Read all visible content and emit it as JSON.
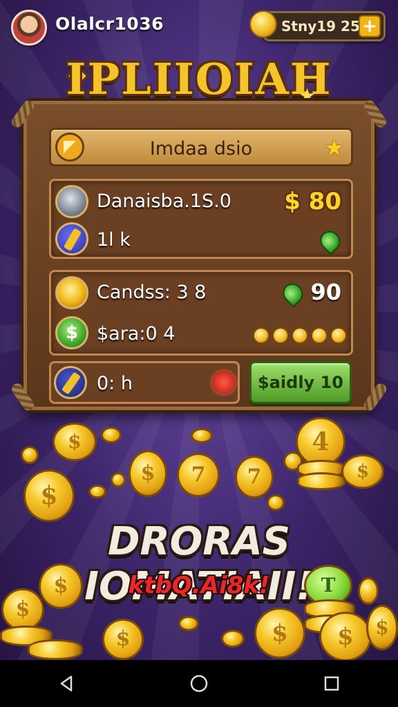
{
  "header": {
    "username": "Olalcr1036",
    "currency_label": "Stny19 25",
    "plus_label": "+"
  },
  "title": "IPLIIOIAH",
  "board": {
    "header_text": "Imdaa dsio",
    "row1": {
      "label": "Danaisba.1S.0",
      "price": "$ 80"
    },
    "row2": {
      "label": "1l k"
    },
    "row3": {
      "label": "Candss: 3 8",
      "value": "90"
    },
    "row4": {
      "label": "$ara:0 4",
      "pips": 5
    },
    "row5": {
      "label": "0: h"
    },
    "action_button": "$aidly 10"
  },
  "promo": {
    "title": "DRORAS IOMATIAII!",
    "subtitle": "ktbQ.Ai8k!"
  },
  "colors": {
    "accent_gold": "#f5c42a",
    "board_wood": "#6b3f22",
    "button_green": "#4e9a26",
    "promo_red": "#e8282a"
  },
  "icons": {
    "back": "back-triangle-icon",
    "home": "home-circle-icon",
    "recents": "recents-square-icon"
  }
}
